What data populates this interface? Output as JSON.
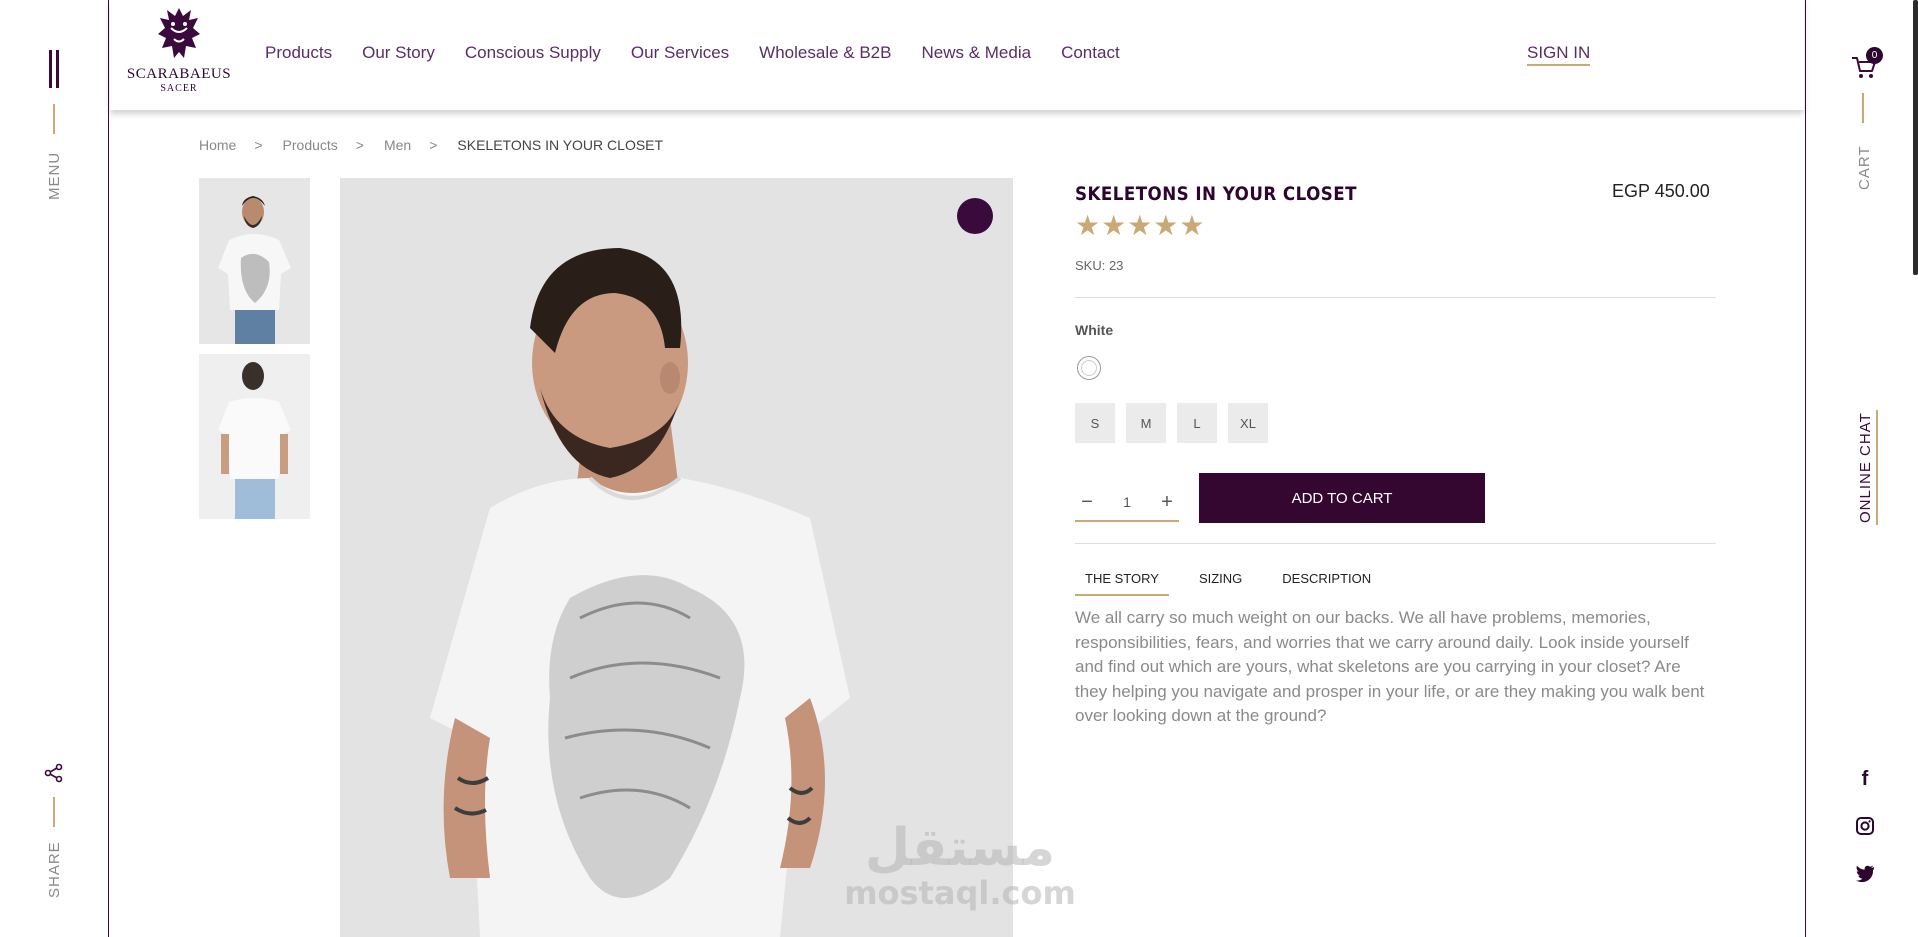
{
  "rails": {
    "menu_label": "MENU",
    "share_label": "SHARE",
    "cart_label": "CART",
    "cart_count": "0",
    "chat_label": "ONLINE CHAT",
    "social": [
      "facebook-icon",
      "instagram-icon",
      "twitter-icon"
    ]
  },
  "header": {
    "brand_name": "SCARABAEUS",
    "brand_sub": "SACER",
    "nav": [
      "Products",
      "Our Story",
      "Conscious Supply",
      "Our Services",
      "Wholesale & B2B",
      "News & Media",
      "Contact"
    ],
    "sign_in": "SIGN IN"
  },
  "breadcrumb": [
    "Home",
    "Products",
    "Men",
    "SKELETONS IN YOUR CLOSET"
  ],
  "breadcrumb_separator": ">",
  "product": {
    "title": "SKELETONS IN YOUR CLOSET",
    "price": "EGP 450.00",
    "stars": "★★★★★",
    "rating": 5,
    "sku": "SKU: 23",
    "color_label": "White",
    "sizes": [
      "S",
      "M",
      "L",
      "XL"
    ],
    "qty_minus": "−",
    "qty_value": "1",
    "qty_plus": "+",
    "add_to_cart": "ADD TO CART",
    "tabs": [
      "THE STORY",
      "SIZING",
      "DESCRIPTION"
    ],
    "active_tab": "THE STORY",
    "story": "We all carry so much weight on our backs. We all have problems, memories, responsibilities, fears, and worries that we carry around daily. Look inside yourself and find out which are yours, what skeletons are you carrying in your closet? Are they helping you navigate and prosper in your life, or are they making you walk bent over looking down at the ground?"
  },
  "watermark": {
    "arabic": "مستقل",
    "latin": "mostaql.com"
  },
  "colors": {
    "brand_purple": "#33072f",
    "gold_accent": "#c9a975",
    "nav_text": "#5a2d66"
  }
}
